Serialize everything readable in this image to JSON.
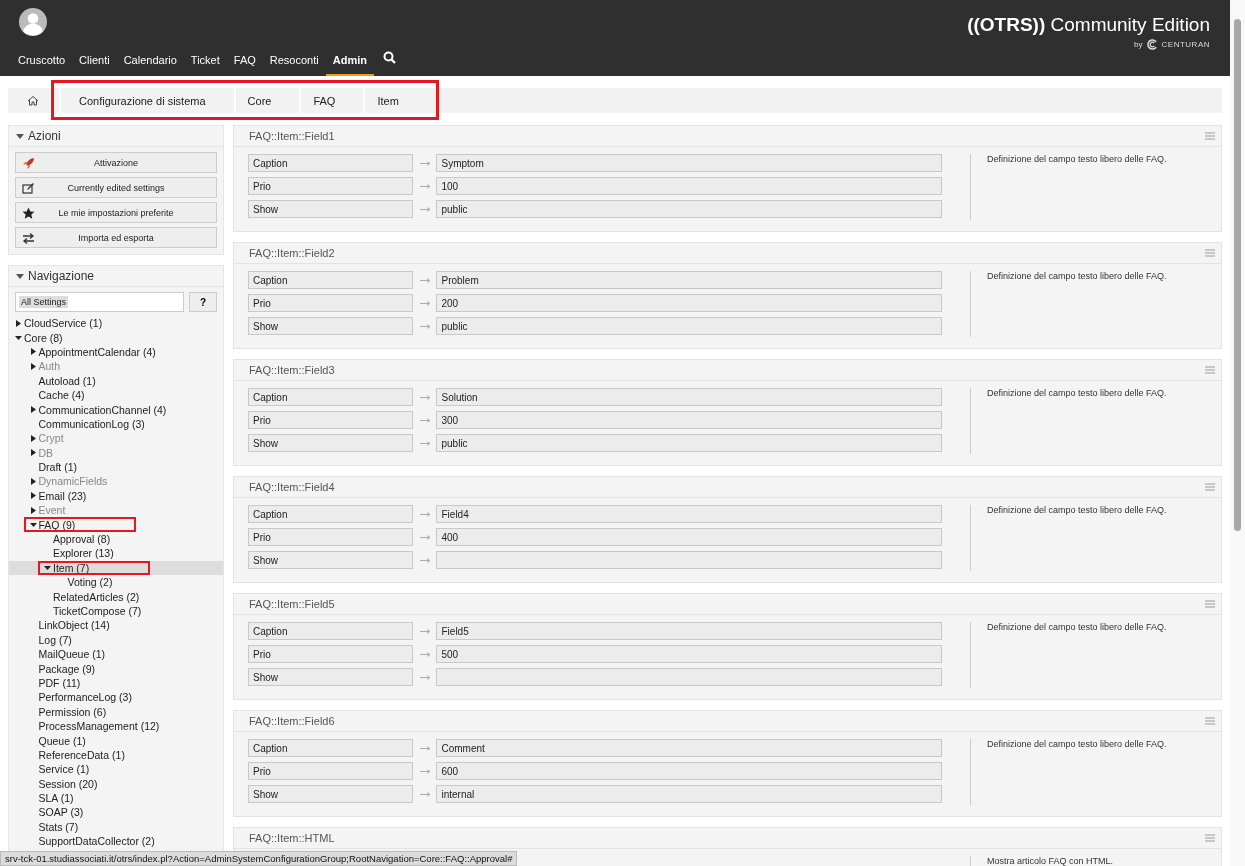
{
  "header": {
    "nav": [
      {
        "label": "Cruscotto",
        "selected": false
      },
      {
        "label": "Clienti",
        "selected": false
      },
      {
        "label": "Calendario",
        "selected": false
      },
      {
        "label": "Ticket",
        "selected": false
      },
      {
        "label": "FAQ",
        "selected": false
      },
      {
        "label": "Resoconti",
        "selected": false
      },
      {
        "label": "Admin",
        "selected": true
      }
    ],
    "logo": {
      "title": "**((OTRS))** Community Edition",
      "by": "by",
      "vendor": "CENTURAN"
    }
  },
  "breadcrumb": {
    "highlighted": true,
    "items": [
      "Configurazione di sistema",
      "Core",
      "FAQ",
      "Item"
    ]
  },
  "sidebar": {
    "actions": {
      "title": "Azioni",
      "buttons": [
        "Attivazione",
        "Currently edited settings",
        "Le mie impostazioni preferite",
        "Importa ed esporta"
      ]
    },
    "navigation": {
      "title": "Navigazione",
      "filter": {
        "value": "All Settings"
      },
      "help": "?",
      "tree": [
        {
          "label": "CloudService (1)",
          "kind": "folder",
          "expanded": false,
          "disabled": false,
          "selected": false,
          "highlighted": false
        },
        {
          "label": "Core (8)",
          "kind": "folder",
          "expanded": true,
          "disabled": false,
          "selected": false,
          "highlighted": false,
          "children": [
            {
              "label": "AppointmentCalendar (4)",
              "kind": "folder",
              "expanded": false,
              "disabled": false,
              "selected": false,
              "highlighted": false
            },
            {
              "label": "Auth",
              "kind": "folder",
              "expanded": false,
              "disabled": true,
              "selected": false,
              "highlighted": false
            },
            {
              "label": "Autoload (1)",
              "kind": "leaf",
              "disabled": false,
              "selected": false,
              "highlighted": false
            },
            {
              "label": "Cache (4)",
              "kind": "leaf",
              "disabled": false,
              "selected": false,
              "highlighted": false
            },
            {
              "label": "CommunicationChannel (4)",
              "kind": "folder",
              "expanded": false,
              "disabled": false,
              "selected": false,
              "highlighted": false
            },
            {
              "label": "CommunicationLog (3)",
              "kind": "leaf",
              "disabled": false,
              "selected": false,
              "highlighted": false
            },
            {
              "label": "Crypt",
              "kind": "folder",
              "expanded": false,
              "disabled": true,
              "selected": false,
              "highlighted": false
            },
            {
              "label": "DB",
              "kind": "folder",
              "expanded": false,
              "disabled": true,
              "selected": false,
              "highlighted": false
            },
            {
              "label": "Draft (1)",
              "kind": "leaf",
              "disabled": false,
              "selected": false,
              "highlighted": false
            },
            {
              "label": "DynamicFields",
              "kind": "folder",
              "expanded": false,
              "disabled": true,
              "selected": false,
              "highlighted": false
            },
            {
              "label": "Email (23)",
              "kind": "folder",
              "expanded": false,
              "disabled": false,
              "selected": false,
              "highlighted": false
            },
            {
              "label": "Event",
              "kind": "folder",
              "expanded": false,
              "disabled": true,
              "selected": false,
              "highlighted": false
            },
            {
              "label": "FAQ (9)",
              "kind": "folder",
              "expanded": true,
              "disabled": false,
              "selected": false,
              "highlighted": true,
              "children": [
                {
                  "label": "Approval (8)",
                  "kind": "leaf",
                  "disabled": false,
                  "selected": false,
                  "highlighted": false
                },
                {
                  "label": "Explorer (13)",
                  "kind": "leaf",
                  "disabled": false,
                  "selected": false,
                  "highlighted": false
                },
                {
                  "label": "Item (7)",
                  "kind": "folder",
                  "expanded": true,
                  "disabled": false,
                  "selected": true,
                  "highlighted": true,
                  "children": [
                    {
                      "label": "Voting (2)",
                      "kind": "leaf",
                      "disabled": false,
                      "selected": false,
                      "highlighted": false
                    }
                  ]
                },
                {
                  "label": "RelatedArticles (2)",
                  "kind": "leaf",
                  "disabled": false,
                  "selected": false,
                  "highlighted": false
                },
                {
                  "label": "TicketCompose (7)",
                  "kind": "leaf",
                  "disabled": false,
                  "selected": false,
                  "highlighted": false
                }
              ]
            },
            {
              "label": "LinkObject (14)",
              "kind": "leaf",
              "disabled": false,
              "selected": false,
              "highlighted": false
            },
            {
              "label": "Log (7)",
              "kind": "leaf",
              "disabled": false,
              "selected": false,
              "highlighted": false
            },
            {
              "label": "MailQueue (1)",
              "kind": "leaf",
              "disabled": false,
              "selected": false,
              "highlighted": false
            },
            {
              "label": "Package (9)",
              "kind": "leaf",
              "disabled": false,
              "selected": false,
              "highlighted": false
            },
            {
              "label": "PDF (11)",
              "kind": "leaf",
              "disabled": false,
              "selected": false,
              "highlighted": false
            },
            {
              "label": "PerformanceLog (3)",
              "kind": "leaf",
              "disabled": false,
              "selected": false,
              "highlighted": false
            },
            {
              "label": "Permission (6)",
              "kind": "leaf",
              "disabled": false,
              "selected": false,
              "highlighted": false
            },
            {
              "label": "ProcessManagement (12)",
              "kind": "leaf",
              "disabled": false,
              "selected": false,
              "highlighted": false
            },
            {
              "label": "Queue (1)",
              "kind": "leaf",
              "disabled": false,
              "selected": false,
              "highlighted": false
            },
            {
              "label": "ReferenceData (1)",
              "kind": "leaf",
              "disabled": false,
              "selected": false,
              "highlighted": false
            },
            {
              "label": "Service (1)",
              "kind": "leaf",
              "disabled": false,
              "selected": false,
              "highlighted": false
            },
            {
              "label": "Session (20)",
              "kind": "leaf",
              "disabled": false,
              "selected": false,
              "highlighted": false
            },
            {
              "label": "SLA (1)",
              "kind": "leaf",
              "disabled": false,
              "selected": false,
              "highlighted": false
            },
            {
              "label": "SOAP (3)",
              "kind": "leaf",
              "disabled": false,
              "selected": false,
              "highlighted": false
            },
            {
              "label": "Stats (7)",
              "kind": "leaf",
              "disabled": false,
              "selected": false,
              "highlighted": false
            },
            {
              "label": "SupportDataCollector (2)",
              "kind": "leaf",
              "disabled": false,
              "selected": false,
              "highlighted": false
            }
          ]
        }
      ]
    }
  },
  "settings": [
    {
      "title": "FAQ::Item::Field1",
      "rows": [
        {
          "key": "Caption",
          "value": "Symptom"
        },
        {
          "key": "Prio",
          "value": "100"
        },
        {
          "key": "Show",
          "value": "public"
        }
      ],
      "description": "Definizione del campo testo libero delle FAQ."
    },
    {
      "title": "FAQ::Item::Field2",
      "rows": [
        {
          "key": "Caption",
          "value": "Problem"
        },
        {
          "key": "Prio",
          "value": "200"
        },
        {
          "key": "Show",
          "value": "public"
        }
      ],
      "description": "Definizione del campo testo libero delle FAQ."
    },
    {
      "title": "FAQ::Item::Field3",
      "rows": [
        {
          "key": "Caption",
          "value": "Solution"
        },
        {
          "key": "Prio",
          "value": "300"
        },
        {
          "key": "Show",
          "value": "public"
        }
      ],
      "description": "Definizione del campo testo libero delle FAQ."
    },
    {
      "title": "FAQ::Item::Field4",
      "rows": [
        {
          "key": "Caption",
          "value": "Field4"
        },
        {
          "key": "Prio",
          "value": "400"
        },
        {
          "key": "Show"
        }
      ],
      "description": "Definizione del campo testo libero delle FAQ."
    },
    {
      "title": "FAQ::Item::Field5",
      "rows": [
        {
          "key": "Caption",
          "value": "Field5"
        },
        {
          "key": "Prio",
          "value": "500"
        },
        {
          "key": "Show"
        }
      ],
      "description": "Definizione del campo testo libero delle FAQ."
    },
    {
      "title": "FAQ::Item::Field6",
      "rows": [
        {
          "key": "Caption",
          "value": "Comment"
        },
        {
          "key": "Prio",
          "value": "600"
        },
        {
          "key": "Show",
          "value": "internal"
        }
      ],
      "description": "Definizione del campo testo libero delle FAQ."
    },
    {
      "title": "FAQ::Item::HTML",
      "description": "Mostra articolo FAQ con HTML."
    }
  ],
  "status_url": "srv-tck-01.studiassociati.it/otrs/index.pl?Action=AdminSystemConfigurationGroup;RootNavigation=Core::FAQ::Approval#"
}
